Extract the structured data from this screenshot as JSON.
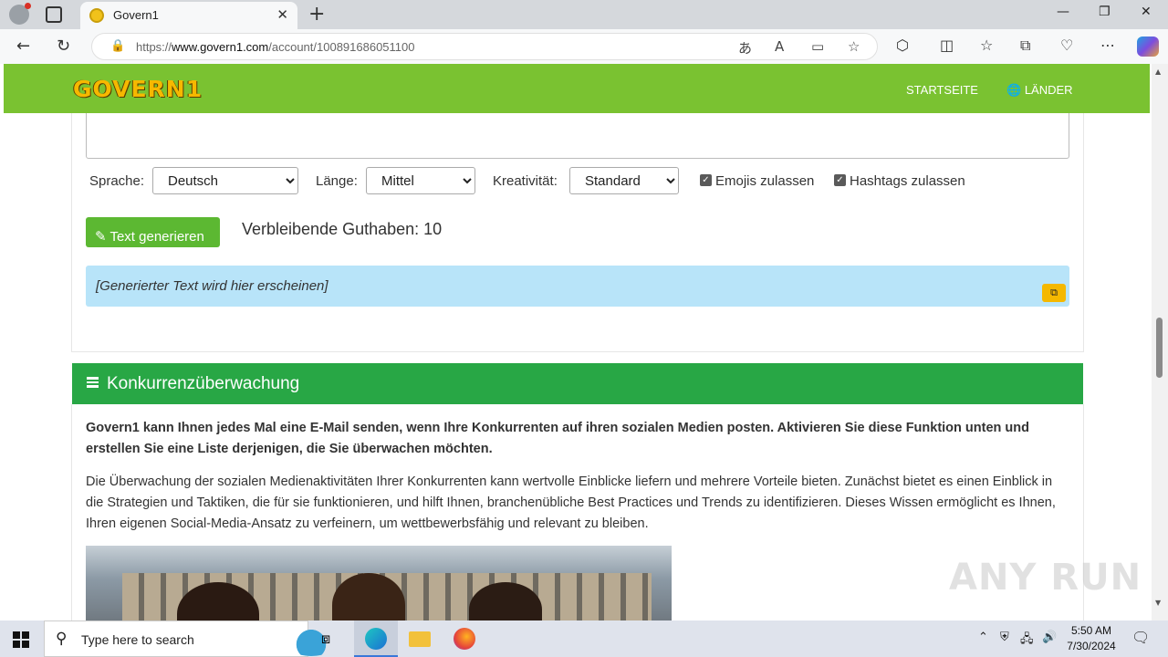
{
  "browser": {
    "tab_title": "Govern1",
    "url_prefix": "https://",
    "url_domain": "www.govern1.com",
    "url_path": "/account/100891686051100"
  },
  "site": {
    "logo": "GOVERN1",
    "nav": [
      "STARTSEITE",
      "LÄNDER"
    ]
  },
  "generator": {
    "language_label": "Sprache:",
    "language_value": "Deutsch",
    "length_label": "Länge:",
    "length_value": "Mittel",
    "creativity_label": "Kreativität:",
    "creativity_value": "Standard",
    "emojis_label": "Emojis zulassen",
    "hashtags_label": "Hashtags zulassen",
    "generate_button": "Text generieren",
    "credits": "Verbleibende Guthaben: 10",
    "output_placeholder": "[Generierter Text wird hier erscheinen]"
  },
  "competitor": {
    "title": "Konkurrenzüberwachung",
    "lead": "Govern1 kann Ihnen jedes Mal eine E-Mail senden, wenn Ihre Konkurrenten auf ihren sozialen Medien posten. Aktivieren Sie diese Funktion unten und erstellen Sie eine Liste derjenigen, die Sie überwachen möchten.",
    "paragraph": "Die Überwachung der sozialen Medienaktivitäten Ihrer Konkurrenten kann wertvolle Einblicke liefern und mehrere Vorteile bieten. Zunächst bietet es einen Einblick in die Strategien und Taktiken, die für sie funktionieren, und hilft Ihnen, branchenübliche Best Practices und Trends zu identifizieren. Dieses Wissen ermöglicht es Ihnen, Ihren eigenen Social-Media-Ansatz zu verfeinern, um wettbewerbsfähig und relevant zu bleiben."
  },
  "watermark": "ANY RUN",
  "taskbar": {
    "search_placeholder": "Type here to search",
    "time": "5:50 AM",
    "date": "7/30/2024"
  },
  "colors": {
    "site_nav": "#7ac231",
    "section_header": "#28a745",
    "output_bg": "#b8e4f9",
    "generate_button": "#5cb832"
  }
}
